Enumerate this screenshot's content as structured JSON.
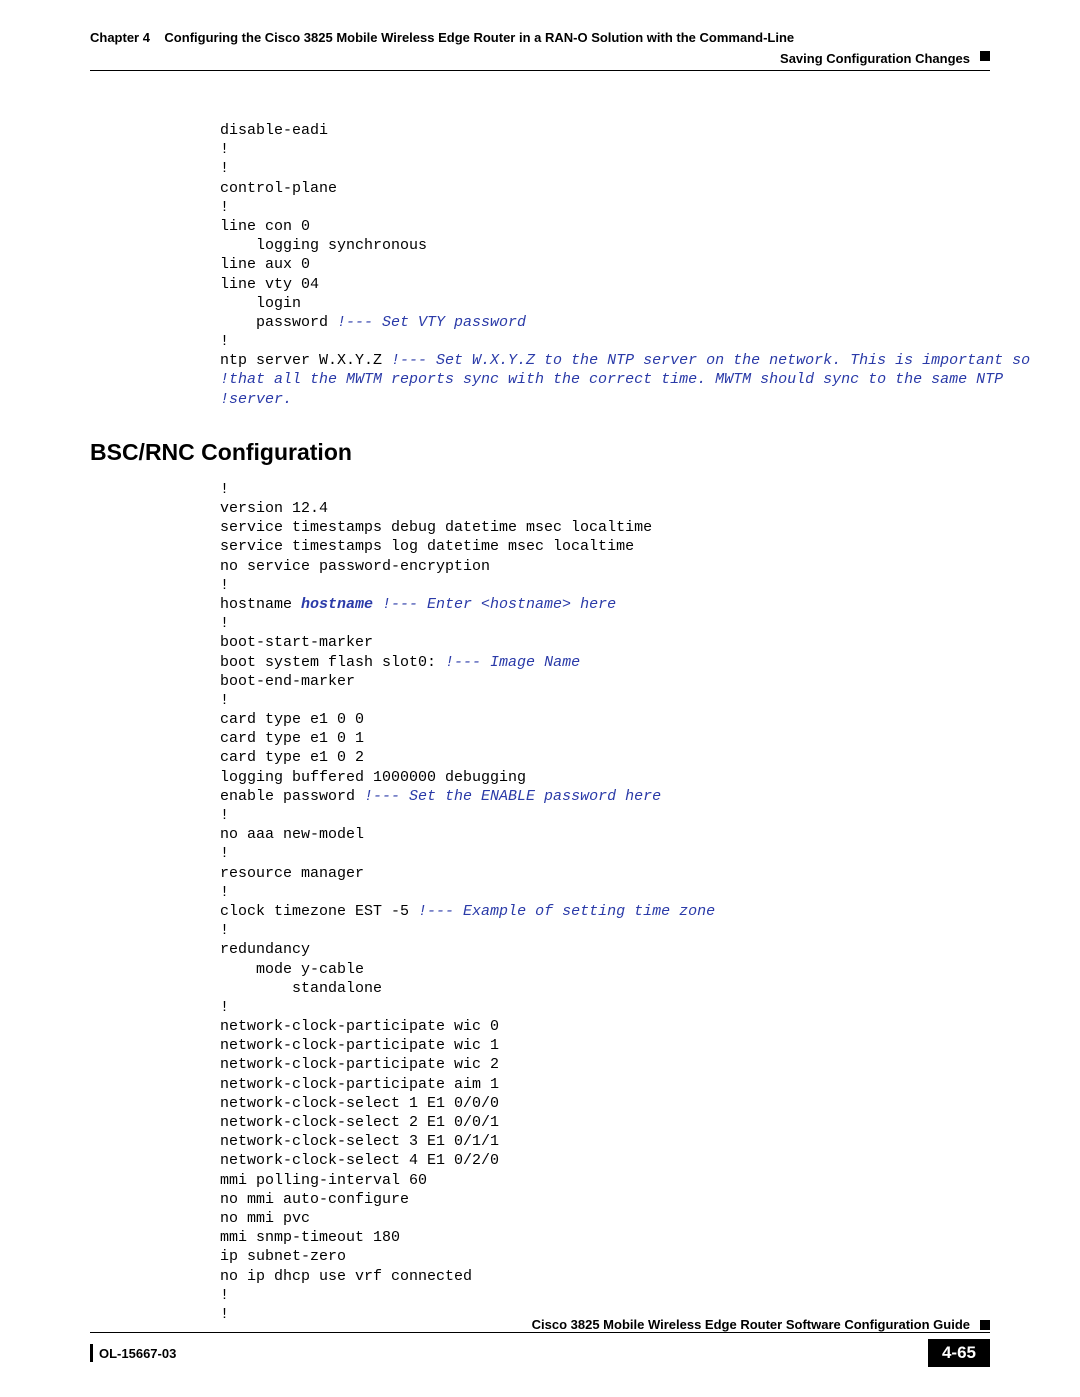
{
  "header": {
    "chapter": "Chapter 4",
    "title": "Configuring the Cisco 3825 Mobile Wireless Edge Router in a RAN-O Solution with the Command-Line",
    "section": "Saving Configuration Changes"
  },
  "code1": {
    "l1": "disable-eadi",
    "l2": "!",
    "l3": "!",
    "l4": "control-plane",
    "l5": "!",
    "l6": "line con 0",
    "l7": "    logging synchronous",
    "l8": "line aux 0",
    "l9": "line vty 04",
    "l10": "    login",
    "l11a": "    password ",
    "l11b": "!--- Set VTY password",
    "l12": "!",
    "l13a": "ntp server W.X.Y.Z ",
    "l13b": "!--- Set W.X.Y.Z to the NTP server on the network. This is important so",
    "l14": "!that all the MWTM reports sync with the correct time. MWTM should sync to the same NTP",
    "l15": "!server."
  },
  "heading": "BSC/RNC Configuration",
  "code2": {
    "l1": "!",
    "l2": "version 12.4",
    "l3": "service timestamps debug datetime msec localtime",
    "l4": "service timestamps log datetime msec localtime",
    "l5": "no service password-encryption",
    "l6": "!",
    "l7a": "hostname ",
    "l7b": "hostname",
    "l7c": " !--- Enter <hostname> here",
    "l8": "!",
    "l9": "boot-start-marker",
    "l10a": "boot system flash slot0: ",
    "l10b": "!--- Image Name",
    "l11": "boot-end-marker",
    "l12": "!",
    "l13": "card type e1 0 0",
    "l14": "card type e1 0 1",
    "l15": "card type e1 0 2",
    "l16": "logging buffered 1000000 debugging",
    "l17a": "enable password ",
    "l17b": "!--- Set the ENABLE password here",
    "l18": "!",
    "l19": "no aaa new-model",
    "l20": "!",
    "l21": "resource manager",
    "l22": "!",
    "l23a": "clock timezone EST -5 ",
    "l23b": "!--- Example of setting time zone",
    "l24": "!",
    "l25": "redundancy",
    "l26": "    mode y-cable",
    "l27": "        standalone",
    "l28": "!",
    "l29": "network-clock-participate wic 0",
    "l30": "network-clock-participate wic 1",
    "l31": "network-clock-participate wic 2",
    "l32": "network-clock-participate aim 1",
    "l33": "network-clock-select 1 E1 0/0/0",
    "l34": "network-clock-select 2 E1 0/0/1",
    "l35": "network-clock-select 3 E1 0/1/1",
    "l36": "network-clock-select 4 E1 0/2/0",
    "l37": "mmi polling-interval 60",
    "l38": "no mmi auto-configure",
    "l39": "no mmi pvc",
    "l40": "mmi snmp-timeout 180",
    "l41": "ip subnet-zero",
    "l42": "no ip dhcp use vrf connected",
    "l43": "!",
    "l44": "!"
  },
  "footer": {
    "guide": "Cisco 3825 Mobile Wireless Edge Router Software Configuration Guide",
    "doc_id": "OL-15667-03",
    "page": "4-65"
  }
}
